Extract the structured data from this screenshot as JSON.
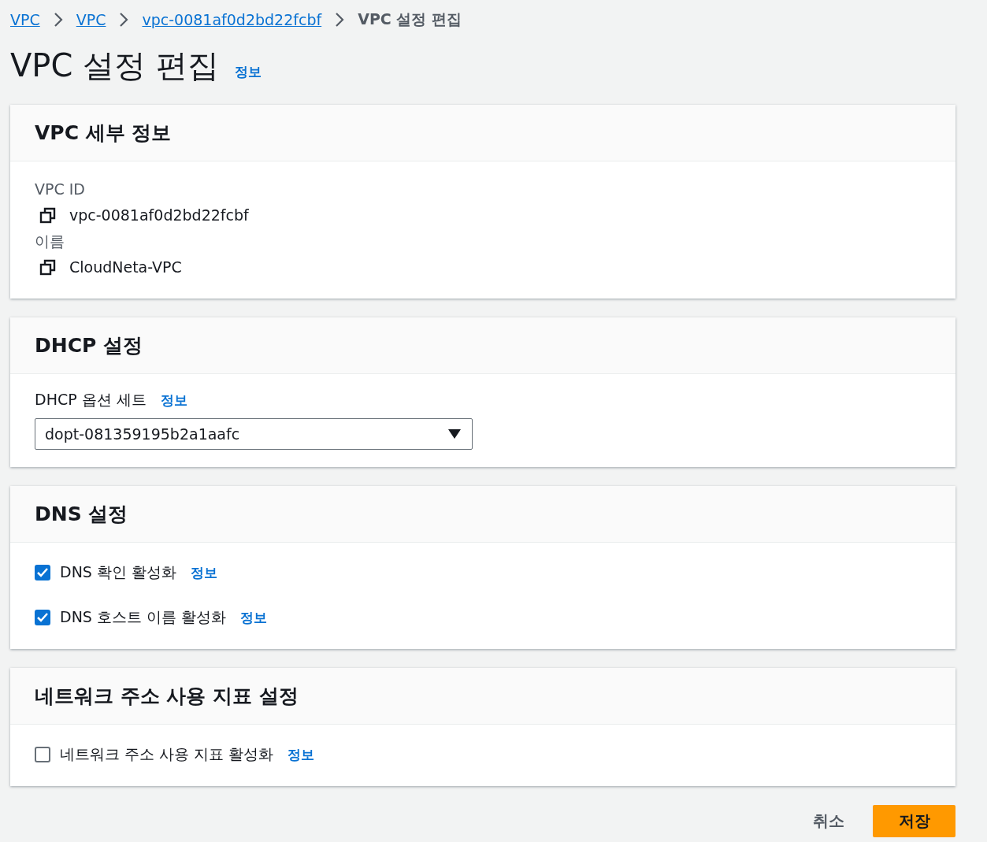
{
  "breadcrumbs": [
    {
      "label": "VPC",
      "kind": "link"
    },
    {
      "label": "VPC",
      "kind": "link"
    },
    {
      "label": "vpc-0081af0d2bd22fcbf",
      "kind": "link"
    },
    {
      "label": "VPC 설정 편집",
      "kind": "current"
    }
  ],
  "title": "VPC 설정 편집",
  "title_info": "정보",
  "sections": [
    {
      "kind": "details",
      "title": "VPC 세부 정보",
      "fields": [
        {
          "label": "VPC ID",
          "value": "vpc-0081af0d2bd22fcbf"
        },
        {
          "label": "이름",
          "value": "CloudNeta-VPC"
        }
      ]
    },
    {
      "kind": "select",
      "title": "DHCP 설정",
      "label": "DHCP 옵션 세트",
      "info": "정보",
      "value": "dopt-081359195b2a1aafc"
    },
    {
      "kind": "checkboxes",
      "title": "DNS 설정",
      "options": [
        {
          "label": "DNS 확인 활성화",
          "info": "정보",
          "checked": true
        },
        {
          "label": "DNS 호스트 이름 활성화",
          "info": "정보",
          "checked": true
        }
      ]
    },
    {
      "kind": "checkboxes",
      "title": "네트워크 주소 사용 지표 설정",
      "options": [
        {
          "label": "네트워크 주소 사용 지표 활성화",
          "info": "정보",
          "checked": false
        }
      ]
    }
  ],
  "footer": {
    "cancel": "취소",
    "save": "저장"
  }
}
